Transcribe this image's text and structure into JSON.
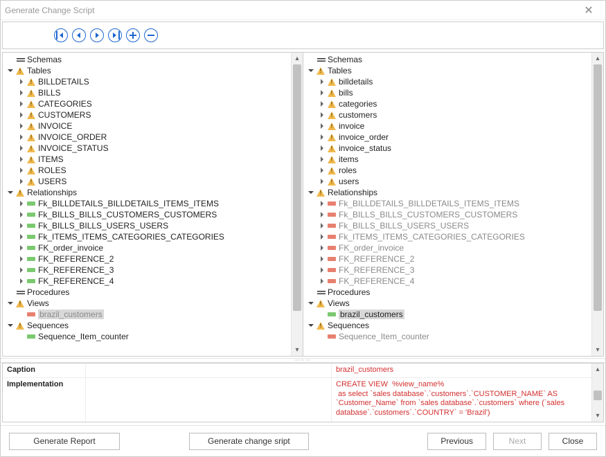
{
  "window_title": "Generate Change Script",
  "toolbar": {
    "first": "First",
    "prev": "Previous",
    "next": "Next",
    "last": "Last",
    "add": "Add",
    "remove": "Remove"
  },
  "left_tree": {
    "schemas": "Schemas",
    "tables": "Tables",
    "table_items": [
      "BILLDETAILS",
      "BILLS",
      "CATEGORIES",
      "CUSTOMERS",
      "INVOICE",
      "INVOICE_ORDER",
      "INVOICE_STATUS",
      "ITEMS",
      "ROLES",
      "USERS"
    ],
    "relationships": "Relationships",
    "rel_items": [
      "Fk_BILLDETAILS_BILLDETAILS_ITEMS_ITEMS",
      "Fk_BILLS_BILLS_CUSTOMERS_CUSTOMERS",
      "Fk_BILLS_BILLS_USERS_USERS",
      "Fk_ITEMS_ITEMS_CATEGORIES_CATEGORIES",
      "FK_order_invoice",
      "FK_REFERENCE_2",
      "FK_REFERENCE_3",
      "FK_REFERENCE_4"
    ],
    "procedures": "Procedures",
    "views": "Views",
    "view_items": [
      "brazil_customers"
    ],
    "sequences": "Sequences",
    "seq_items": [
      "Sequence_Item_counter"
    ]
  },
  "right_tree": {
    "schemas": "Schemas",
    "tables": "Tables",
    "table_items": [
      "billdetails",
      "bills",
      "categories",
      "customers",
      "invoice",
      "invoice_order",
      "invoice_status",
      "items",
      "roles",
      "users"
    ],
    "relationships": "Relationships",
    "rel_items": [
      "Fk_BILLDETAILS_BILLDETAILS_ITEMS_ITEMS",
      "Fk_BILLS_BILLS_CUSTOMERS_CUSTOMERS",
      "Fk_BILLS_BILLS_USERS_USERS",
      "Fk_ITEMS_ITEMS_CATEGORIES_CATEGORIES",
      "FK_order_invoice",
      "FK_REFERENCE_2",
      "FK_REFERENCE_3",
      "FK_REFERENCE_4"
    ],
    "procedures": "Procedures",
    "views": "Views",
    "view_items": [
      "brazil_customers"
    ],
    "sequences": "Sequences",
    "seq_items": [
      "Sequence_Item_counter"
    ]
  },
  "detail": {
    "caption_label": "Caption",
    "caption_value_right": "brazil_customers",
    "impl_label": "Implementation",
    "impl_value_right": "CREATE VIEW  %view_name%\n as select `sales database`.`customers`.`CUSTOMER_NAME` AS `Customer_Name` from `sales database`.`customers` where (`sales database`.`customers`.`COUNTRY` = 'Brazil')"
  },
  "footer": {
    "generate_report": "Generate Report",
    "generate_script": "Generate change sript",
    "previous": "Previous",
    "next": "Next",
    "close": "Close"
  }
}
